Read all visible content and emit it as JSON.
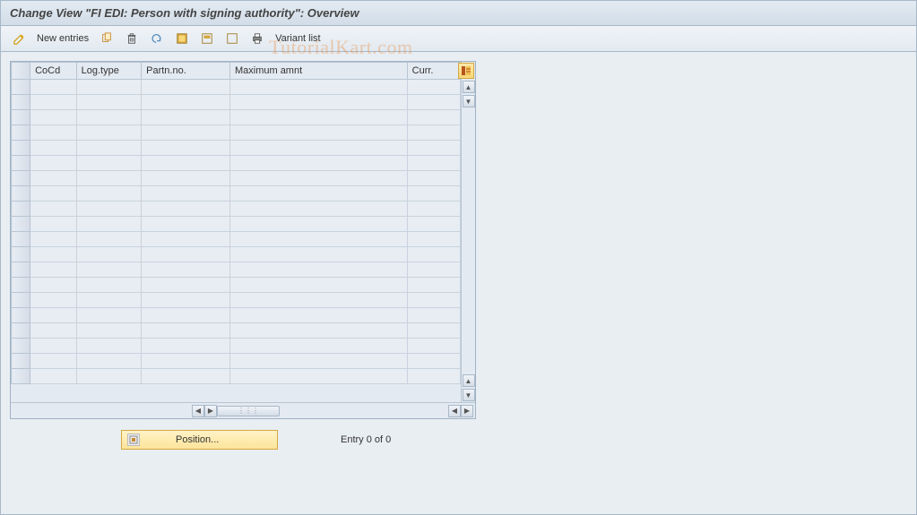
{
  "title": "Change View \"FI EDI: Person with signing authority\": Overview",
  "toolbar": {
    "new_entries_label": "New entries",
    "variant_list_label": "Variant list"
  },
  "table": {
    "columns": [
      "CoCd",
      "Log.type",
      "Partn.no.",
      "Maximum amnt",
      "Curr."
    ],
    "row_count": 20
  },
  "footer": {
    "position_label": "Position...",
    "entry_status": "Entry 0 of 0"
  },
  "watermark": "TutorialKart.com"
}
